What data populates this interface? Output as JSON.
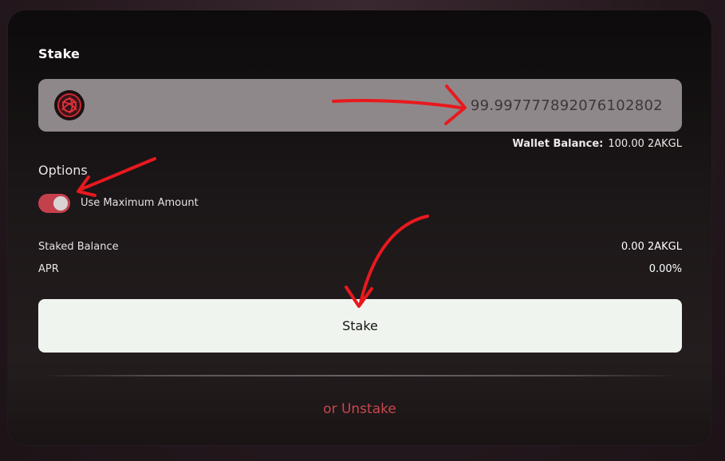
{
  "title": "Stake",
  "amount_input": {
    "value": "99.997777892076102802",
    "token_icon": "token-logo-icon"
  },
  "wallet_balance": {
    "label": "Wallet Balance:",
    "value": "100.00 2AKGL"
  },
  "options": {
    "label": "Options",
    "use_max": {
      "label": "Use Maximum Amount",
      "checked": true
    }
  },
  "stats": {
    "staked_balance_label": "Staked Balance",
    "staked_balance_value": "0.00 2AKGL",
    "apr_label": "APR",
    "apr_value": "0.00%"
  },
  "stake_button_label": "Stake",
  "unstake_link_label": "or Unstake",
  "colors": {
    "accent": "#c4414c",
    "annotation": "#e8191e",
    "button_bg": "#f0f4ef"
  }
}
